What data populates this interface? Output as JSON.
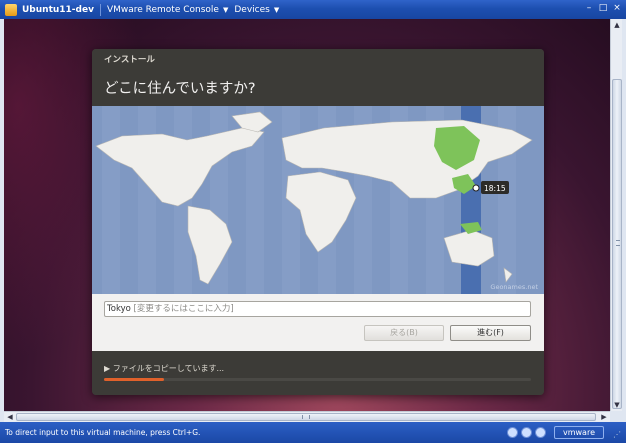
{
  "window": {
    "title": "Ubuntu11-dev",
    "menus": [
      "VMware Remote Console",
      "Devices"
    ],
    "controls": [
      "minimize",
      "restore",
      "close"
    ]
  },
  "installer": {
    "header_label": "インストール",
    "question": "どこに住んでいますか?",
    "map": {
      "time_label": "18:15",
      "credit": "Geonames.net"
    },
    "location_input": {
      "value": "Tokyo",
      "placeholder": "[変更するにはここに入力]"
    },
    "back_button": "戻る(B)",
    "next_button": "進む(F)",
    "progress": {
      "label": "ファイルをコピーしています...",
      "fraction": 0.14
    }
  },
  "statusbar": {
    "text": "To direct input to this virtual machine, press Ctrl+G.",
    "brand": "vmware"
  },
  "colors": {
    "titlebar": "#1d4fb0",
    "installer_bg": "#3c3b37",
    "map_ocean": "#7f98c2",
    "selected_zone": "#4a6fb0",
    "selected_region": "#7ec35a",
    "progress": "#e0612b"
  }
}
